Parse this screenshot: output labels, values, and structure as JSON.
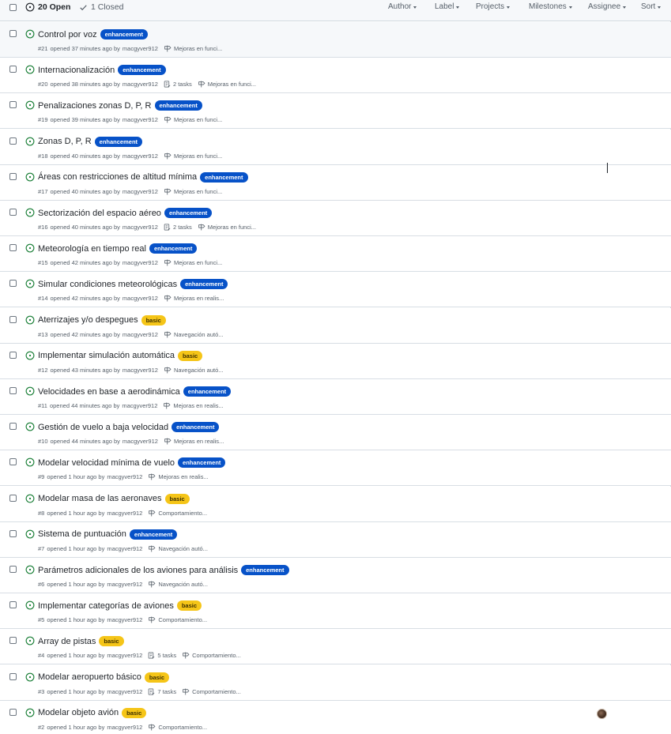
{
  "header": {
    "open_count": "20 Open",
    "closed_count": "1 Closed",
    "filters": [
      "Author",
      "Label",
      "Projects",
      "Milestones",
      "Assignee",
      "Sort"
    ]
  },
  "colors": {
    "enhancement": "#0752c8",
    "basic": "#f5c518",
    "open_icon": "#1a7f37"
  },
  "issues": [
    {
      "title": "Control por voz",
      "label": "enhancement",
      "number": "#21",
      "opened": "opened 37 minutes ago by",
      "author": "macgyver912",
      "tasks": "",
      "milestone": "Mejoras en funci..."
    },
    {
      "title": "Internacionalización",
      "label": "enhancement",
      "number": "#20",
      "opened": "opened 38 minutes ago by",
      "author": "macgyver912",
      "tasks": "2 tasks",
      "milestone": "Mejoras en funci..."
    },
    {
      "title": "Penalizaciones zonas D, P, R",
      "label": "enhancement",
      "number": "#19",
      "opened": "opened 39 minutes ago by",
      "author": "macgyver912",
      "tasks": "",
      "milestone": "Mejoras en funci..."
    },
    {
      "title": "Zonas D, P, R",
      "label": "enhancement",
      "number": "#18",
      "opened": "opened 40 minutes ago by",
      "author": "macgyver912",
      "tasks": "",
      "milestone": "Mejoras en funci..."
    },
    {
      "title": "Áreas con restricciones de altitud mínima",
      "label": "enhancement",
      "number": "#17",
      "opened": "opened 40 minutes ago by",
      "author": "macgyver912",
      "tasks": "",
      "milestone": "Mejoras en funci..."
    },
    {
      "title": "Sectorización del espacio aéreo",
      "label": "enhancement",
      "number": "#16",
      "opened": "opened 40 minutes ago by",
      "author": "macgyver912",
      "tasks": "2 tasks",
      "milestone": "Mejoras en funci..."
    },
    {
      "title": "Meteorología en tiempo real",
      "label": "enhancement",
      "number": "#15",
      "opened": "opened 42 minutes ago by",
      "author": "macgyver912",
      "tasks": "",
      "milestone": "Mejoras en funci..."
    },
    {
      "title": "Simular condiciones meteorológicas",
      "label": "enhancement",
      "number": "#14",
      "opened": "opened 42 minutes ago by",
      "author": "macgyver912",
      "tasks": "",
      "milestone": "Mejoras en realis..."
    },
    {
      "title": "Aterrizajes y/o despegues",
      "label": "basic",
      "number": "#13",
      "opened": "opened 42 minutes ago by",
      "author": "macgyver912",
      "tasks": "",
      "milestone": "Navegación autó..."
    },
    {
      "title": "Implementar simulación automática",
      "label": "basic",
      "number": "#12",
      "opened": "opened 43 minutes ago by",
      "author": "macgyver912",
      "tasks": "",
      "milestone": "Navegación autó..."
    },
    {
      "title": "Velocidades en base a aerodinámica",
      "label": "enhancement",
      "number": "#11",
      "opened": "opened 44 minutes ago by",
      "author": "macgyver912",
      "tasks": "",
      "milestone": "Mejoras en realis..."
    },
    {
      "title": "Gestión de vuelo a baja velocidad",
      "label": "enhancement",
      "number": "#10",
      "opened": "opened 44 minutes ago by",
      "author": "macgyver912",
      "tasks": "",
      "milestone": "Mejoras en realis..."
    },
    {
      "title": "Modelar velocidad mínima de vuelo",
      "label": "enhancement",
      "number": "#9",
      "opened": "opened 1 hour ago by",
      "author": "macgyver912",
      "tasks": "",
      "milestone": "Mejoras en realis..."
    },
    {
      "title": "Modelar masa de las aeronaves",
      "label": "basic",
      "number": "#8",
      "opened": "opened 1 hour ago by",
      "author": "macgyver912",
      "tasks": "",
      "milestone": "Comportamiento..."
    },
    {
      "title": "Sistema de puntuación",
      "label": "enhancement",
      "number": "#7",
      "opened": "opened 1 hour ago by",
      "author": "macgyver912",
      "tasks": "",
      "milestone": "Navegación autó..."
    },
    {
      "title": "Parámetros adicionales de los aviones para análisis",
      "label": "enhancement",
      "number": "#6",
      "opened": "opened 1 hour ago by",
      "author": "macgyver912",
      "tasks": "",
      "milestone": "Navegación autó..."
    },
    {
      "title": "Implementar categorías de aviones",
      "label": "basic",
      "number": "#5",
      "opened": "opened 1 hour ago by",
      "author": "macgyver912",
      "tasks": "",
      "milestone": "Comportamiento..."
    },
    {
      "title": "Array de pistas",
      "label": "basic",
      "number": "#4",
      "opened": "opened 1 hour ago by",
      "author": "macgyver912",
      "tasks": "5 tasks",
      "milestone": "Comportamiento..."
    },
    {
      "title": "Modelar aeropuerto básico",
      "label": "basic",
      "number": "#3",
      "opened": "opened 1 hour ago by",
      "author": "macgyver912",
      "tasks": "7 tasks",
      "milestone": "Comportamiento..."
    },
    {
      "title": "Modelar objeto avión",
      "label": "basic",
      "number": "#2",
      "opened": "opened 1 hour ago by",
      "author": "macgyver912",
      "tasks": "",
      "milestone": "Comportamiento..."
    }
  ]
}
